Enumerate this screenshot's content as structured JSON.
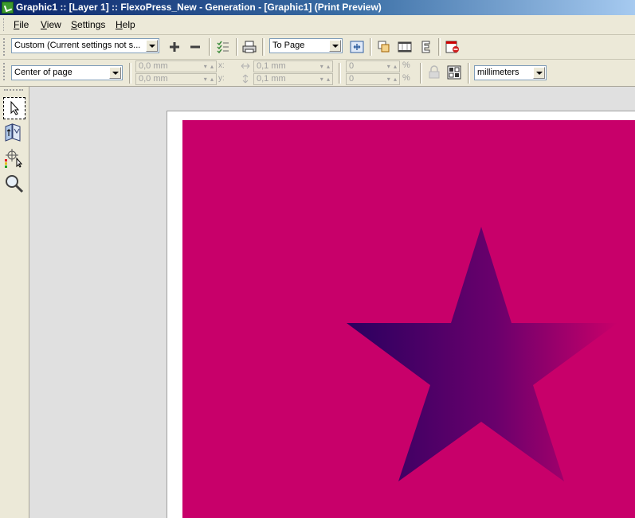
{
  "window": {
    "title": "Graphic1 :: [Layer 1] :: FlexoPress_New - Generation  - [Graphic1] (Print Preview)",
    "app_icon": "app-icon"
  },
  "menu": {
    "items": [
      {
        "label_ul": "F",
        "label_rest": "ile"
      },
      {
        "label_ul": "V",
        "label_rest": "iew"
      },
      {
        "label_ul": "S",
        "label_rest": "ettings"
      },
      {
        "label_ul": "H",
        "label_rest": "elp"
      }
    ]
  },
  "toolbar1": {
    "preset_value": "Custom (Current settings not s...",
    "zoom_mode_value": "To Page",
    "icons": [
      "add-icon",
      "remove-icon",
      "checklist-icon",
      "print-icon",
      "fit-page-icon",
      "copies-icon",
      "film-icon",
      "text-frame-icon",
      "exit-preview-icon"
    ]
  },
  "toolbar2": {
    "position_value": "Center of page",
    "x_value": "0,0 mm",
    "y_value": "0,0 mm",
    "x_axis": "x:",
    "y_axis": "y:",
    "w_value": "0,1 mm",
    "h_value": "0,1 mm",
    "scale_x_value": "0",
    "scale_y_value": "0",
    "percent": "%",
    "units_value": "millimeters",
    "icons": [
      "lock-icon",
      "tile-icon"
    ]
  },
  "tools": [
    "select-tool-icon",
    "page-flip-tool-icon",
    "color-picker-tool-icon",
    "zoom-tool-icon"
  ],
  "colors": {
    "artboard": "#c8006a",
    "star_gradient_start": "#2a0060",
    "star_gradient_end": "#c8006a"
  }
}
